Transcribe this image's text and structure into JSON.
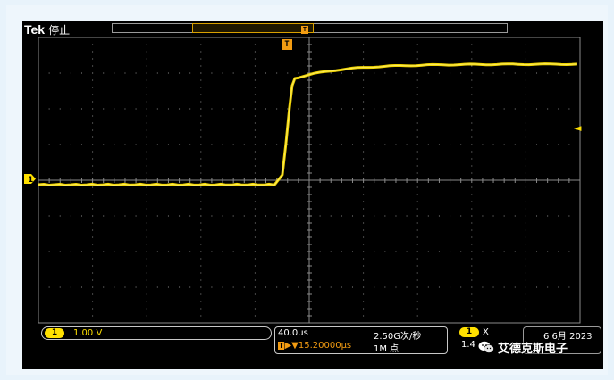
{
  "brand": {
    "name": "Tek",
    "state": "停止"
  },
  "markers": {
    "trigger_top": "T",
    "trigger_graticule": "T",
    "ch1_ground": "1",
    "trigger_level_arrow": "◄"
  },
  "colors": {
    "ch1": "#ffe000",
    "trigger": "#f39c12",
    "grid": "#8a8a8a",
    "background": "#000000"
  },
  "channel": {
    "number": "1",
    "scale": "1.00 V"
  },
  "timebase": {
    "scale": "40.0µs",
    "sample_rate": "2.50G次/秒",
    "position_label": "T",
    "position": "▶▼15.20000µs",
    "record_length": "1M 点"
  },
  "trigger": {
    "channel": "1",
    "slope": "X",
    "level": "1.4"
  },
  "date": {
    "text": "6 6月 2023"
  },
  "watermark": {
    "text": "艾德克斯电子",
    "icon": "wechat-icon"
  },
  "waveform": {
    "type": "step",
    "low_level_div": -0.1,
    "high_level_div": 3.25,
    "overshoot_start_div": 2.85,
    "rise_time_div": 0.18,
    "edge_time_div": -0.1
  }
}
